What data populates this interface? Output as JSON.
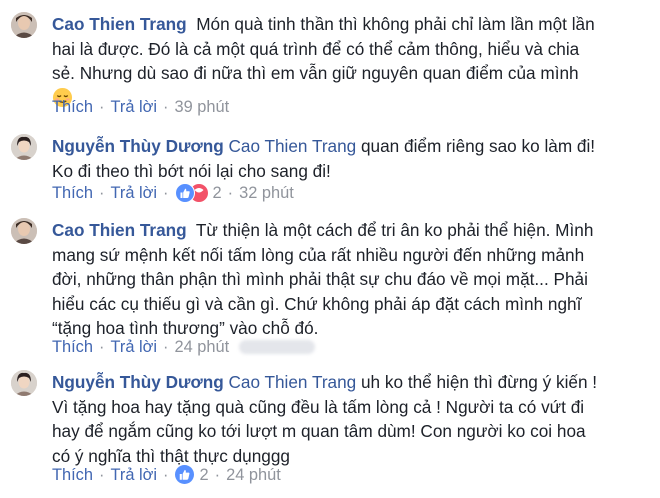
{
  "comments": [
    {
      "author": "Cao Thien Trang",
      "mention": "",
      "lines": [
        "Món quà tinh thần thì không phải chỉ làm lần một lần",
        "hai là được. Đó là cả một quá trình để có thể cảm thông, hiểu và chia",
        "sẻ. Nhưng dù sao đi nữa thì em vẫn giữ nguyên quan điểm của mình"
      ],
      "emoji": "relieved-face-emoji",
      "like": "Thích",
      "reply": "Trả lời",
      "reaction_count": "",
      "time": "39 phút"
    },
    {
      "author": "Nguyễn Thùy Dương",
      "mention": "Cao Thien Trang",
      "lines": [
        "quan điểm riêng sao ko làm đi!",
        "Ko đi theo thì bớt nói lại cho sang đi!"
      ],
      "like": "Thích",
      "reply": "Trả lời",
      "reaction_count": "2",
      "reactions": [
        "like-icon",
        "haha-icon"
      ],
      "time": "32 phút"
    },
    {
      "author": "Cao Thien Trang",
      "mention": "",
      "lines": [
        "Từ thiện là một cách để tri ân ko phải thể hiện. Mình",
        "mang sứ mệnh kết nối tấm lòng của rất nhiều người đến những mảnh",
        "đời, những thân phận thì mình phải thật sự chu đáo về mọi mặt... Phải",
        "hiểu các cụ thiếu gì và cần gì. Chứ không phải áp đặt cách mình nghĩ",
        "“tặng hoa tình thương” vào chỗ đó."
      ],
      "like": "Thích",
      "reply": "Trả lời",
      "reaction_count": "",
      "time": "24 phút"
    },
    {
      "author": "Nguyễn Thùy Dương",
      "mention": "Cao Thien Trang",
      "lines": [
        "uh ko thể hiện thì đừng ý kiến !",
        "Vì tặng hoa hay tặng quà cũng đều là tấm lòng cả ! Người ta có vứt đi",
        "hay để ngắm cũng ko tới lượt m quan tâm dùm! Con người ko coi hoa",
        "có ý nghĩa thì thật thực dụnggg"
      ],
      "like": "Thích",
      "reply": "Trả lời",
      "reaction_count": "2",
      "reactions": [
        "like-icon"
      ],
      "time": "24 phút"
    }
  ],
  "separator": "·",
  "colors": {
    "name": "#365899",
    "text": "#1d2129",
    "meta": "#90949c",
    "action": "#4267b2",
    "like_bubble": "#5890ff",
    "haha_bubble": "#f25268"
  }
}
